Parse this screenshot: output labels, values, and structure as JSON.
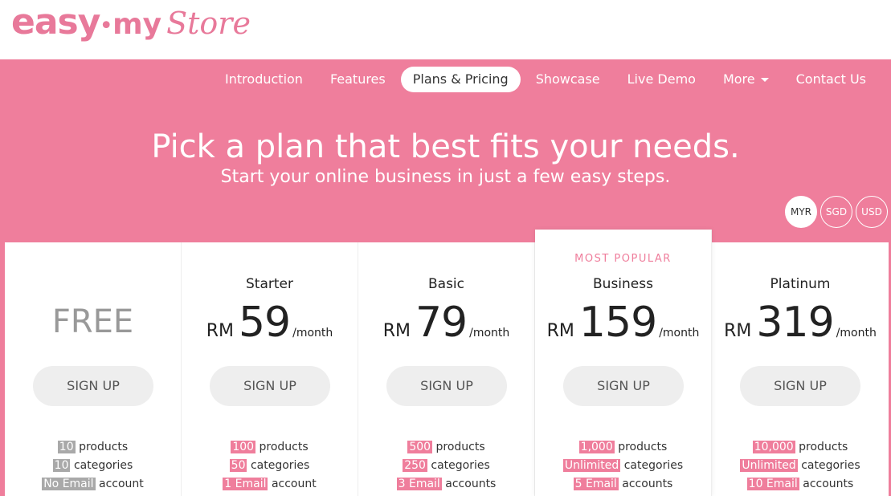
{
  "logo": {
    "easy": "easy",
    "dot": "•",
    "my": "my",
    "store": "Store"
  },
  "nav": {
    "items": [
      {
        "label": "Introduction"
      },
      {
        "label": "Features"
      },
      {
        "label": "Plans & Pricing",
        "active": true
      },
      {
        "label": "Showcase"
      },
      {
        "label": "Live Demo"
      },
      {
        "label": "More",
        "dropdown": true
      },
      {
        "label": "Contact Us"
      }
    ]
  },
  "hero": {
    "headline": "Pick a plan that best fits your needs.",
    "subline": "Start your online business in just a few easy steps."
  },
  "currency": {
    "options": [
      "MYR",
      "SGD",
      "USD"
    ],
    "selected": "MYR"
  },
  "plans": [
    {
      "name": "",
      "free_label": "FREE",
      "signup": "SIGN UP",
      "features": [
        {
          "value": "10",
          "label": "products"
        },
        {
          "value": "10",
          "label": "categories"
        },
        {
          "value": "No Email",
          "label": "account"
        }
      ]
    },
    {
      "name": "Starter",
      "currency": "RM",
      "amount": "59",
      "period": "/month",
      "signup": "SIGN UP",
      "features": [
        {
          "value": "100",
          "label": "products"
        },
        {
          "value": "50",
          "label": "categories"
        },
        {
          "value": "1 Email",
          "label": "account"
        }
      ]
    },
    {
      "name": "Basic",
      "currency": "RM",
      "amount": "79",
      "period": "/month",
      "signup": "SIGN UP",
      "features": [
        {
          "value": "500",
          "label": "products"
        },
        {
          "value": "250",
          "label": "categories"
        },
        {
          "value": "3 Email",
          "label": "accounts"
        }
      ]
    },
    {
      "badge": "MOST POPULAR",
      "name": "Business",
      "currency": "RM",
      "amount": "159",
      "period": "/month",
      "signup": "SIGN UP",
      "features": [
        {
          "value": "1,000",
          "label": "products"
        },
        {
          "value": "Unlimited",
          "label": "categories"
        },
        {
          "value": "5 Email",
          "label": "accounts"
        }
      ]
    },
    {
      "name": "Platinum",
      "currency": "RM",
      "amount": "319",
      "period": "/month",
      "signup": "SIGN UP",
      "features": [
        {
          "value": "10,000",
          "label": "products"
        },
        {
          "value": "Unlimited",
          "label": "categories"
        },
        {
          "value": "10 Email",
          "label": "accounts"
        }
      ]
    }
  ],
  "colors": {
    "brand_pink": "#ef7e9c",
    "free_badge_grey": "#a9a9a9",
    "signup_bg": "#eeeeee"
  }
}
